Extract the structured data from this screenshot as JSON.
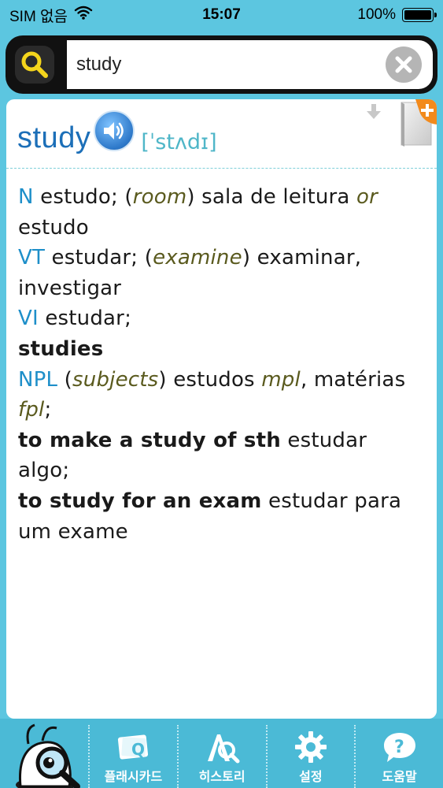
{
  "status_bar": {
    "carrier": "SIM 없음",
    "time": "15:07",
    "battery": "100%",
    "battery_level": 1.0
  },
  "search": {
    "query": "study",
    "icon": "search-icon",
    "clear_icon": "clear-icon"
  },
  "entry": {
    "headword": "study",
    "pronunciation": "[ˈstʌdɪ]",
    "icons": [
      "speaker-icon",
      "down-arrow-icon",
      "add-flashcard-icon"
    ]
  },
  "definition": {
    "l1_pos": "N",
    "l1_a": " estudo; (",
    "l1_it1": "room",
    "l1_b": ") sala de leitura ",
    "l1_it2": "or",
    "l2": "estudo",
    "l3_pos": "VT",
    "l3_a": " estudar; (",
    "l3_it": "examine",
    "l3_b": ") examinar,",
    "l4": "investigar",
    "l5_pos": "VI",
    "l5_a": " estudar;",
    "l6_bold": "studies",
    "l7_pos": "NPL",
    "l7_a": " (",
    "l7_it1": "subjects",
    "l7_b": ") estudos ",
    "l7_it2": "mpl",
    "l7_c": ", matérias",
    "l8_it": "fpl",
    "l8_a": ";",
    "l9_bold": "to make a study of sth",
    "l9_a": " estudar",
    "l10": "algo;",
    "l11_bold": "to study for an exam",
    "l11_a": " estudar para",
    "l12": "um exame"
  },
  "colors": {
    "background": "#5cc6e0",
    "headword": "#1c6fb8",
    "pronunciation": "#4fb6c8",
    "pos": "#1e8fc9",
    "italic": "#5a5a1e",
    "add_accent": "#f28a1c"
  },
  "tabs": [
    {
      "label": "플래시카드",
      "icon": "flashcard-icon"
    },
    {
      "label": "히스토리",
      "icon": "history-icon"
    },
    {
      "label": "설정",
      "icon": "gear-icon"
    },
    {
      "label": "도움말",
      "icon": "help-icon"
    }
  ]
}
